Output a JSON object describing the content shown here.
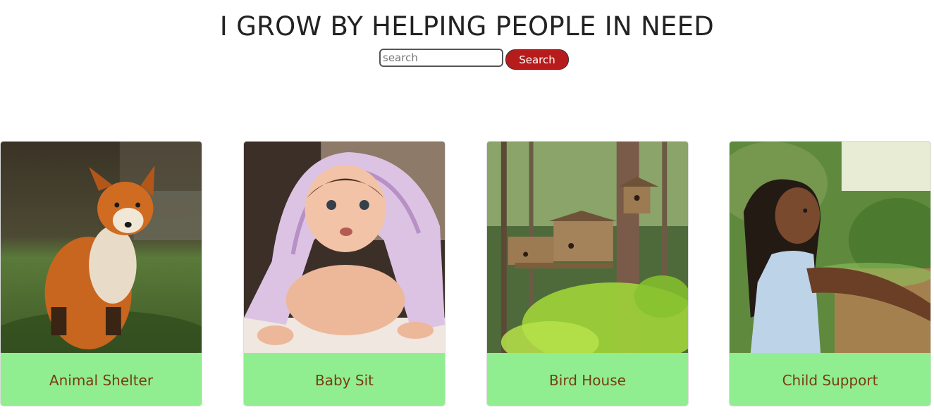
{
  "header": {
    "title": "I GROW BY HELPING PEOPLE IN NEED"
  },
  "search": {
    "placeholder": "search",
    "value": "",
    "button_label": "Search",
    "button_color": "#b71c1c"
  },
  "cards": [
    {
      "title": "Animal Shelter",
      "image": "fox-photo"
    },
    {
      "title": "Baby Sit",
      "image": "baby-photo"
    },
    {
      "title": "Bird House",
      "image": "birdhouse-photo"
    },
    {
      "title": "Child Support",
      "image": "child-photo"
    }
  ],
  "colors": {
    "card_footer": "#90ee90",
    "card_title": "#7a3b10"
  }
}
